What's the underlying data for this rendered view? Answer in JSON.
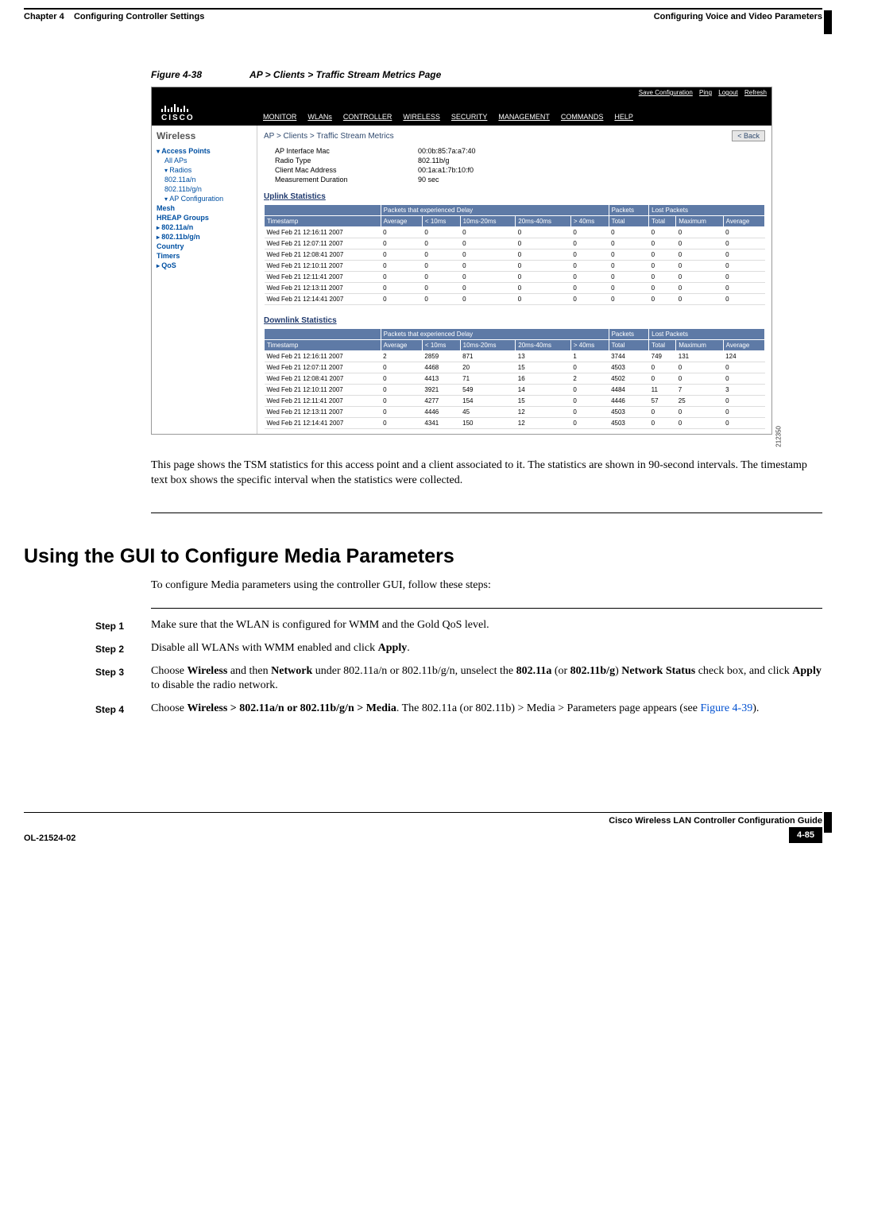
{
  "header": {
    "chapter_label": "Chapter 4",
    "chapter_title": "Configuring Controller Settings",
    "section_title": "Configuring Voice and Video Parameters"
  },
  "figure": {
    "label": "Figure 4-38",
    "title": "AP > Clients > Traffic Stream Metrics Page",
    "side_code": "212350"
  },
  "cisco": {
    "brand": "CISCO",
    "actions": {
      "save": "Save Configuration",
      "ping": "Ping",
      "logout": "Logout",
      "refresh": "Refresh"
    },
    "menu": [
      "MONITOR",
      "WLANs",
      "CONTROLLER",
      "WIRELESS",
      "SECURITY",
      "MANAGEMENT",
      "COMMANDS",
      "HELP"
    ],
    "sidebar": {
      "title": "Wireless",
      "items": [
        {
          "label": "Access Points",
          "cls": "b tri"
        },
        {
          "label": "All APs",
          "cls": "indent"
        },
        {
          "label": "Radios",
          "cls": "indent tri"
        },
        {
          "label": "802.11a/n",
          "cls": "indent indent"
        },
        {
          "label": "802.11b/g/n",
          "cls": "indent indent"
        },
        {
          "label": "AP Configuration",
          "cls": "indent tri"
        },
        {
          "label": "Mesh",
          "cls": "b"
        },
        {
          "label": "HREAP Groups",
          "cls": "b"
        },
        {
          "label": "802.11a/n",
          "cls": "b trir"
        },
        {
          "label": "802.11b/g/n",
          "cls": "b trir"
        },
        {
          "label": "Country",
          "cls": "b"
        },
        {
          "label": "Timers",
          "cls": "b"
        },
        {
          "label": "QoS",
          "cls": "b trir"
        }
      ]
    },
    "breadcrumb": "AP > Clients > Traffic Stream Metrics",
    "back_label": "< Back",
    "info": [
      {
        "label": "AP Interface Mac",
        "value": "00:0b:85:7a:a7:40"
      },
      {
        "label": "Radio Type",
        "value": "802.11b/g"
      },
      {
        "label": "Client Mac Address",
        "value": "00:1a:a1:7b:10:f0"
      },
      {
        "label": "Measurement Duration",
        "value": "90 sec"
      }
    ],
    "uplink_title": "Uplink Statistics",
    "downlink_title": "Downlink Statistics",
    "group_headers": {
      "delay": "Packets that experienced Delay",
      "packets": "Packets",
      "lost": "Lost Packets"
    },
    "columns": [
      "Timestamp",
      "Average",
      "< 10ms",
      "10ms-20ms",
      "20ms-40ms",
      "> 40ms",
      "Total",
      "Total",
      "Maximum",
      "Average"
    ],
    "chart_data": {
      "type": "table",
      "uplink": [
        {
          "ts": "Wed Feb 21 12:16:11 2007",
          "avg": 0,
          "lt10": 0,
          "r10_20": 0,
          "r20_40": 0,
          "gt40": 0,
          "ptotal": 0,
          "ltotal": 0,
          "lmax": 0,
          "lavg": 0
        },
        {
          "ts": "Wed Feb 21 12:07:11 2007",
          "avg": 0,
          "lt10": 0,
          "r10_20": 0,
          "r20_40": 0,
          "gt40": 0,
          "ptotal": 0,
          "ltotal": 0,
          "lmax": 0,
          "lavg": 0
        },
        {
          "ts": "Wed Feb 21 12:08:41 2007",
          "avg": 0,
          "lt10": 0,
          "r10_20": 0,
          "r20_40": 0,
          "gt40": 0,
          "ptotal": 0,
          "ltotal": 0,
          "lmax": 0,
          "lavg": 0
        },
        {
          "ts": "Wed Feb 21 12:10:11 2007",
          "avg": 0,
          "lt10": 0,
          "r10_20": 0,
          "r20_40": 0,
          "gt40": 0,
          "ptotal": 0,
          "ltotal": 0,
          "lmax": 0,
          "lavg": 0
        },
        {
          "ts": "Wed Feb 21 12:11:41 2007",
          "avg": 0,
          "lt10": 0,
          "r10_20": 0,
          "r20_40": 0,
          "gt40": 0,
          "ptotal": 0,
          "ltotal": 0,
          "lmax": 0,
          "lavg": 0
        },
        {
          "ts": "Wed Feb 21 12:13:11 2007",
          "avg": 0,
          "lt10": 0,
          "r10_20": 0,
          "r20_40": 0,
          "gt40": 0,
          "ptotal": 0,
          "ltotal": 0,
          "lmax": 0,
          "lavg": 0
        },
        {
          "ts": "Wed Feb 21 12:14:41 2007",
          "avg": 0,
          "lt10": 0,
          "r10_20": 0,
          "r20_40": 0,
          "gt40": 0,
          "ptotal": 0,
          "ltotal": 0,
          "lmax": 0,
          "lavg": 0
        }
      ],
      "downlink": [
        {
          "ts": "Wed Feb 21 12:16:11 2007",
          "avg": 2,
          "lt10": 2859,
          "r10_20": 871,
          "r20_40": 13,
          "gt40": 1,
          "ptotal": 3744,
          "ltotal": 749,
          "lmax": 131,
          "lavg": 124
        },
        {
          "ts": "Wed Feb 21 12:07:11 2007",
          "avg": 0,
          "lt10": 4468,
          "r10_20": 20,
          "r20_40": 15,
          "gt40": 0,
          "ptotal": 4503,
          "ltotal": 0,
          "lmax": 0,
          "lavg": 0
        },
        {
          "ts": "Wed Feb 21 12:08:41 2007",
          "avg": 0,
          "lt10": 4413,
          "r10_20": 71,
          "r20_40": 16,
          "gt40": 2,
          "ptotal": 4502,
          "ltotal": 0,
          "lmax": 0,
          "lavg": 0
        },
        {
          "ts": "Wed Feb 21 12:10:11 2007",
          "avg": 0,
          "lt10": 3921,
          "r10_20": 549,
          "r20_40": 14,
          "gt40": 0,
          "ptotal": 4484,
          "ltotal": 11,
          "lmax": 7,
          "lavg": 3
        },
        {
          "ts": "Wed Feb 21 12:11:41 2007",
          "avg": 0,
          "lt10": 4277,
          "r10_20": 154,
          "r20_40": 15,
          "gt40": 0,
          "ptotal": 4446,
          "ltotal": 57,
          "lmax": 25,
          "lavg": 0
        },
        {
          "ts": "Wed Feb 21 12:13:11 2007",
          "avg": 0,
          "lt10": 4446,
          "r10_20": 45,
          "r20_40": 12,
          "gt40": 0,
          "ptotal": 4503,
          "ltotal": 0,
          "lmax": 0,
          "lavg": 0
        },
        {
          "ts": "Wed Feb 21 12:14:41 2007",
          "avg": 0,
          "lt10": 4341,
          "r10_20": 150,
          "r20_40": 12,
          "gt40": 0,
          "ptotal": 4503,
          "ltotal": 0,
          "lmax": 0,
          "lavg": 0
        }
      ]
    }
  },
  "paragraph_after_figure": "This page shows the TSM statistics for this access point and a client associated to it. The statistics are shown in 90-second intervals. The timestamp text box shows the specific interval when the statistics were collected.",
  "section_heading": "Using the GUI to Configure Media Parameters",
  "intro_text": "To configure Media parameters using the controller GUI, follow these steps:",
  "steps": [
    {
      "label": "Step 1",
      "parts": [
        {
          "t": "Make sure that the WLAN is configured for WMM and the Gold QoS level."
        }
      ]
    },
    {
      "label": "Step 2",
      "parts": [
        {
          "t": "Disable all WLANs with WMM enabled and click "
        },
        {
          "t": "Apply",
          "b": true
        },
        {
          "t": "."
        }
      ]
    },
    {
      "label": "Step 3",
      "parts": [
        {
          "t": "Choose "
        },
        {
          "t": "Wireless",
          "b": true
        },
        {
          "t": " and then "
        },
        {
          "t": "Network",
          "b": true
        },
        {
          "t": " under 802.11a/n or 802.11b/g/n, unselect the "
        },
        {
          "t": "802.11a",
          "b": true
        },
        {
          "t": " (or "
        },
        {
          "t": "802.11b/g",
          "b": true
        },
        {
          "t": ") "
        },
        {
          "t": "Network Status",
          "b": true
        },
        {
          "t": " check box, and click "
        },
        {
          "t": "Apply",
          "b": true
        },
        {
          "t": " to disable the radio network."
        }
      ]
    },
    {
      "label": "Step 4",
      "parts": [
        {
          "t": "Choose "
        },
        {
          "t": "Wireless > 802.11a/n or 802.11b/g/n > Media",
          "b": true
        },
        {
          "t": ". The 802.11a (or 802.11b) > Media > Parameters page appears (see "
        },
        {
          "t": "Figure 4-39",
          "link": true
        },
        {
          "t": ")."
        }
      ]
    }
  ],
  "footer": {
    "doc_title": "Cisco Wireless LAN Controller Configuration Guide",
    "doc_id": "OL-21524-02",
    "page_num": "4-85"
  }
}
